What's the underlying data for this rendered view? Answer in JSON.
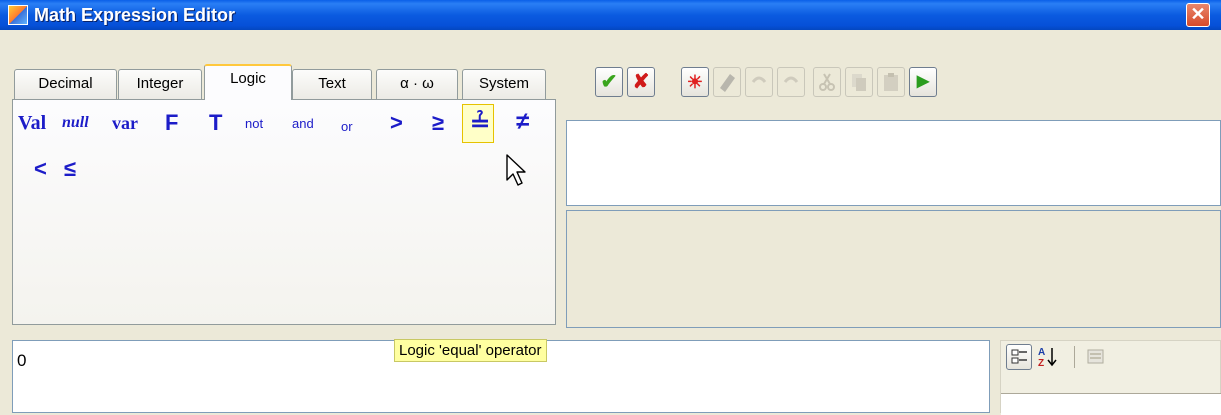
{
  "window": {
    "title": "Math Expression Editor",
    "close_glyph": "✕"
  },
  "tabs": [
    {
      "label": "Decimal"
    },
    {
      "label": "Integer"
    },
    {
      "label": "Logic"
    },
    {
      "label": "Text"
    },
    {
      "label": "α · ω"
    },
    {
      "label": "System"
    }
  ],
  "symbols": {
    "val": "Val",
    "null": "null",
    "var": "var",
    "false": "F",
    "true": "T",
    "not": "not",
    "and": "and",
    "or": "or",
    "gt": ">",
    "ge": "≥",
    "eq": "≟",
    "ne": "≠",
    "lt": "<",
    "le": "≤"
  },
  "toolbar": {
    "ok_glyph": "✔",
    "cancel_glyph": "✘",
    "highlight_glyph": "☀",
    "run_glyph": "▶"
  },
  "expression": {
    "value": "0"
  },
  "tooltip": {
    "text": "Logic 'equal' operator"
  },
  "colors": {
    "title_bar": "#0a5fe8",
    "symbol_blue": "#1c1cc8",
    "ok_green": "#3aa51d",
    "cancel_red": "#d01a1a",
    "tooltip_bg": "#ffffa0"
  }
}
